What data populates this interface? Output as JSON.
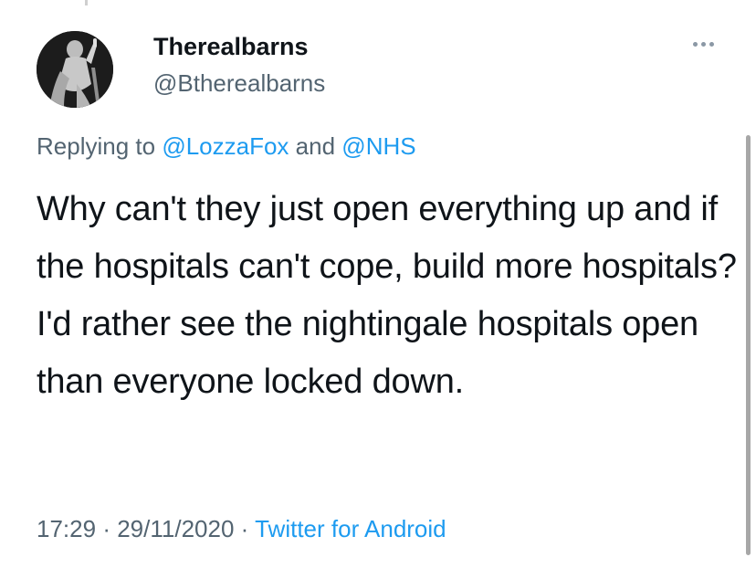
{
  "author": {
    "display_name": "Therealbarns",
    "handle": "@Btherealbarns",
    "avatar_icon": "statue-avatar-icon"
  },
  "more_icon": "more-horizontal-icon",
  "reply_context": {
    "prefix": "Replying to",
    "mention_1": "@LozzaFox",
    "conjunction": "and",
    "mention_2": "@NHS"
  },
  "tweet": {
    "text": "Why can't they just open everything up and if the hospitals can't cope, build more hospitals? I'd rather see the nightingale hospitals open than everyone locked down."
  },
  "meta": {
    "time": "17:29",
    "separator_1": "·",
    "date": "29/11/2020",
    "separator_2": "·",
    "source": "Twitter for Android"
  },
  "colors": {
    "link": "#1d9bf0",
    "secondary_text": "#536471",
    "primary_text": "#0f1419"
  }
}
